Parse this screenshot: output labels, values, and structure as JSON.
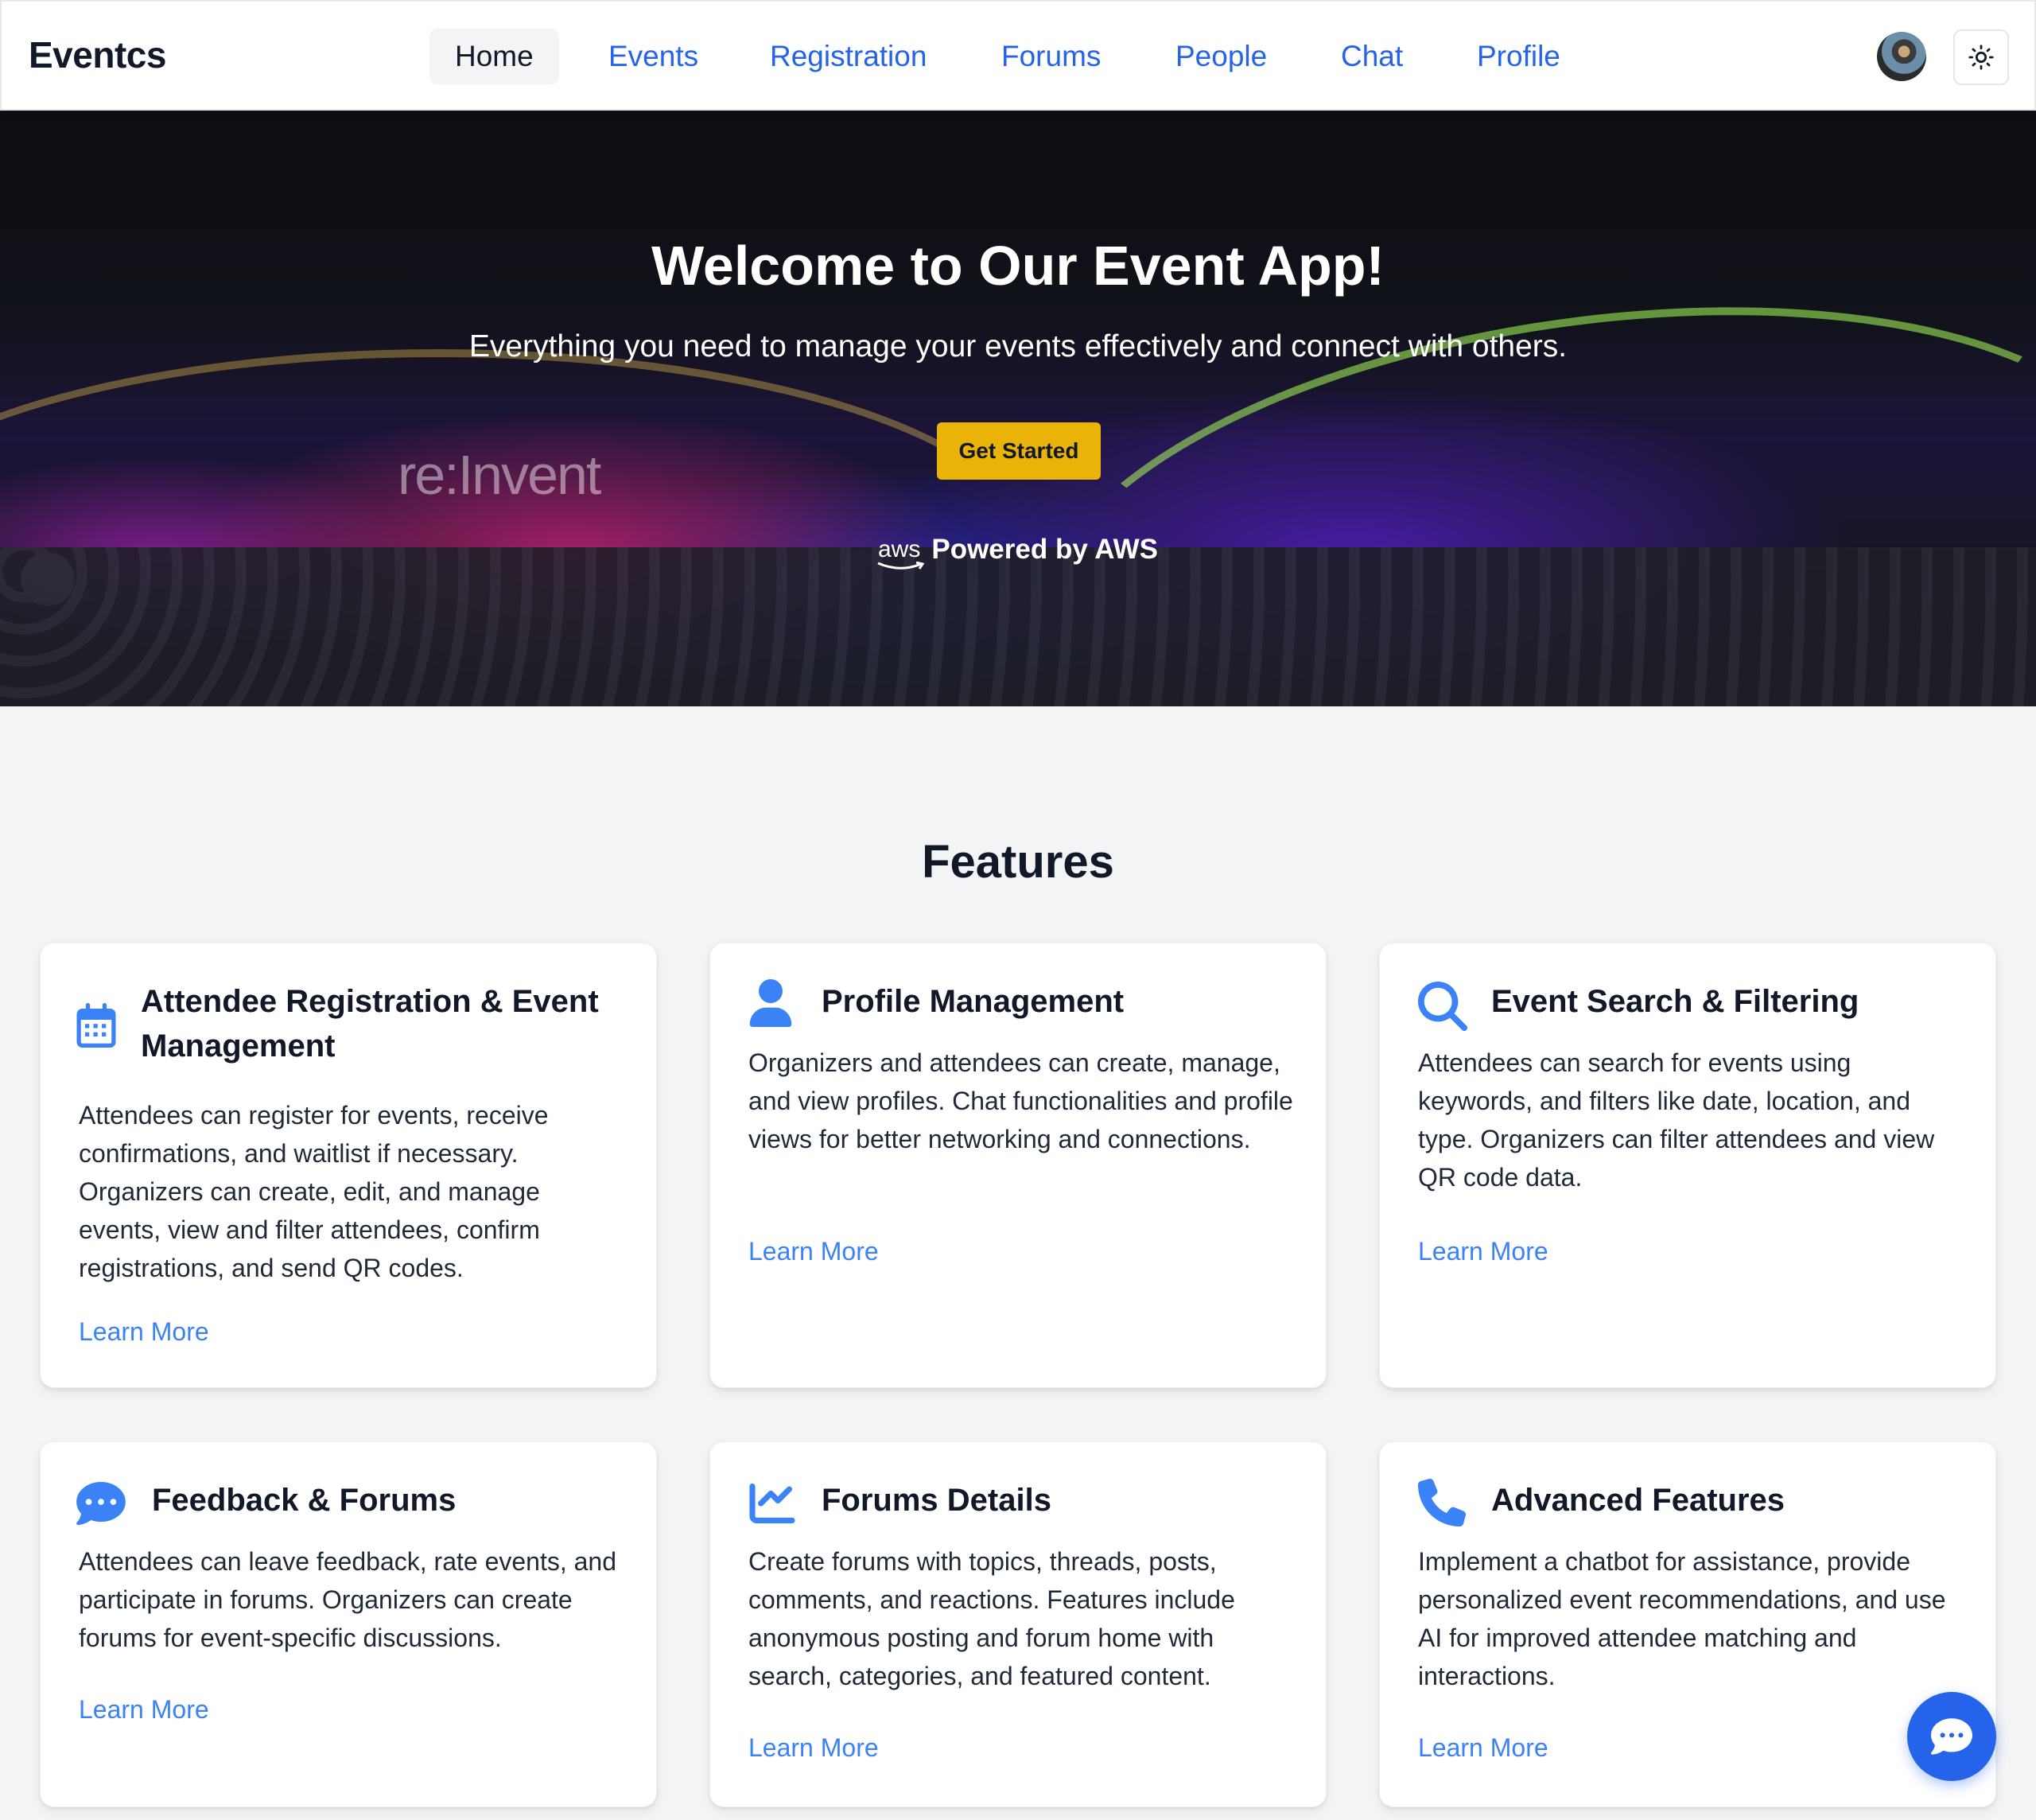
{
  "header": {
    "brand": "Eventcs",
    "nav": [
      {
        "label": "Home",
        "active": true
      },
      {
        "label": "Events",
        "active": false
      },
      {
        "label": "Registration",
        "active": false
      },
      {
        "label": "Forums",
        "active": false
      },
      {
        "label": "People",
        "active": false
      },
      {
        "label": "Chat",
        "active": false
      },
      {
        "label": "Profile",
        "active": false
      }
    ],
    "avatar_icon": "user-avatar",
    "theme_icon": "sun-icon"
  },
  "hero": {
    "title": "Welcome to Our Event App!",
    "subtitle": "Everything you need to manage your events effectively and connect with others.",
    "cta_label": "Get Started",
    "powered_logo": "aws",
    "powered_text": "Powered by AWS",
    "bg_text": "re:Invent"
  },
  "features": {
    "heading": "Features",
    "cards": [
      {
        "icon": "calendar-icon",
        "title_line1": "Attendee Registration & Event",
        "title_line2": "Management",
        "description": "Attendees can register for events, receive confirmations, and waitlist if necessary. Organizers can create, edit, and manage events, view and filter attendees, confirm registrations, and send QR codes.",
        "link": "Learn More"
      },
      {
        "icon": "user-icon",
        "title_line1": "Profile Management",
        "description": "Organizers and attendees can create, manage, and view profiles. Chat functionalities and profile views for better networking and connections.",
        "link": "Learn More"
      },
      {
        "icon": "search-icon",
        "title_line1": "Event Search & Filtering",
        "description": "Attendees can search for events using keywords, and filters like date, location, and type. Organizers can filter attendees and view QR code data.",
        "link": "Learn More"
      },
      {
        "icon": "comment-dots-icon",
        "title_line1": "Feedback & Forums",
        "description": "Attendees can leave feedback, rate events, and participate in forums. Organizers can create forums for event-specific discussions.",
        "link": "Learn More"
      },
      {
        "icon": "chart-line-icon",
        "title_line1": "Forums Details",
        "description": "Create forums with topics, threads, posts, comments, and reactions. Features include anonymous posting and forum home with search, categories, and featured content.",
        "link": "Learn More"
      },
      {
        "icon": "phone-icon",
        "title_line1": "Advanced Features",
        "description": "Implement a chatbot for assistance, provide personalized event recommendations, and use AI for improved attendee matching and interactions.",
        "link": "Learn More"
      }
    ]
  },
  "chat_fab_icon": "chat-bubble-icon",
  "colors": {
    "accent": "#2563eb",
    "link": "#3b82f6",
    "cta": "#eab308",
    "page_bg": "#f3f4f6"
  }
}
